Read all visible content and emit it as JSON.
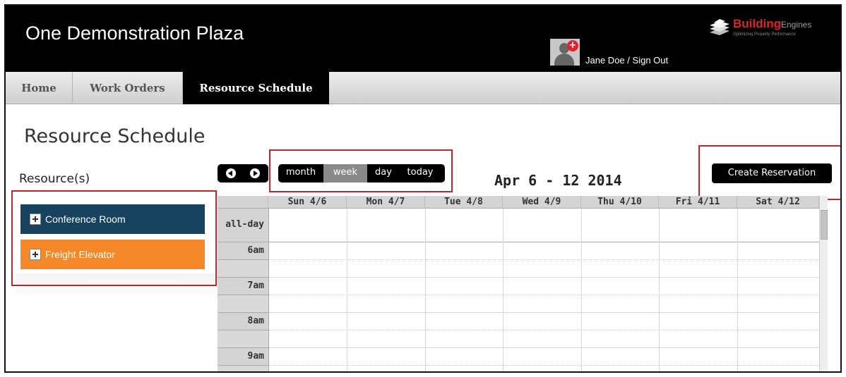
{
  "header": {
    "site_title": "One Demonstration Plaza",
    "user_name": "Jane Doe",
    "separator": "/",
    "sign_out": "Sign Out",
    "brand_bold": "Building",
    "brand_light": "Engines",
    "brand_tagline": "Optimizing Property Performance"
  },
  "nav": {
    "tabs": [
      {
        "label": "Home"
      },
      {
        "label": "Work Orders"
      },
      {
        "label": "Resource Schedule",
        "active": true
      }
    ]
  },
  "page": {
    "title": "Resource Schedule",
    "resources_label": "Resource(s)"
  },
  "resources": [
    {
      "label": "Conference Room",
      "color": "#17435e"
    },
    {
      "label": "Freight Elevator",
      "color": "#f5892a"
    }
  ],
  "toolbar": {
    "views": [
      "month",
      "week",
      "day",
      "today"
    ],
    "active_view": "week",
    "date_range": "Apr 6 - 12 2014",
    "create_label": "Create Reservation"
  },
  "calendar": {
    "days": [
      "Sun 4/6",
      "Mon 4/7",
      "Tue 4/8",
      "Wed 4/9",
      "Thu 4/10",
      "Fri 4/11",
      "Sat 4/12"
    ],
    "all_day_label": "all-day",
    "hours": [
      "6am",
      "7am",
      "8am",
      "9am"
    ]
  },
  "colors": {
    "header_bg": "#000000",
    "highlight_red": "#c0272d",
    "brand_red": "#e0202a"
  }
}
